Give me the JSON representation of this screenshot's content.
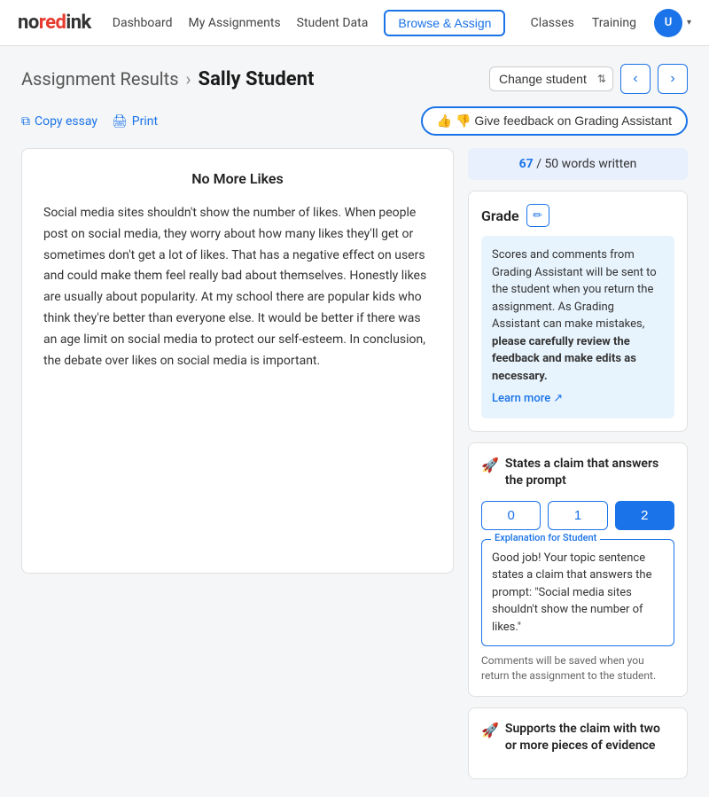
{
  "brand": {
    "no": "no",
    "red": "red",
    "ink": "ink"
  },
  "navbar": {
    "links": [
      {
        "label": "Dashboard",
        "id": "dashboard"
      },
      {
        "label": "My Assignments",
        "id": "my-assignments"
      },
      {
        "label": "Student Data",
        "id": "student-data"
      }
    ],
    "browse_assign": "Browse & Assign",
    "right_links": [
      {
        "label": "Classes",
        "id": "classes"
      },
      {
        "label": "Training",
        "id": "training"
      }
    ],
    "avatar_initials": "U"
  },
  "header": {
    "breadcrumb_link": "Assignment Results",
    "arrow": "›",
    "student_name": "Sally Student",
    "change_student_label": "Change student",
    "change_student_placeholder": "Change student"
  },
  "actions": {
    "copy_essay": "Copy essay",
    "print": "Print",
    "feedback_btn": "👍 👎 Give feedback on Grading Assistant"
  },
  "word_count": {
    "written": "67",
    "target": "50",
    "label": "words written"
  },
  "grade": {
    "label": "Grade",
    "edit_icon": "✏"
  },
  "grading_info": {
    "text1": "Scores and comments from Grading Assistant will be sent to the student when you return the assignment. As Grading Assistant can make mistakes, ",
    "bold": "please carefully review the feedback and make edits as necessary.",
    "learn_more": "Learn more",
    "ext_icon": "↗"
  },
  "criteria1": {
    "icon": "🚀",
    "title": "States a claim that answers the prompt",
    "scores": [
      "0",
      "1",
      "2"
    ],
    "active_score": 2,
    "explanation_label": "Explanation for Student",
    "explanation": "Good job! Your topic sentence states a claim that answers the prompt: \"Social media sites shouldn't show the number of likes.\"",
    "save_note": "Comments will be saved when you return the assignment to the student."
  },
  "criteria2": {
    "icon": "🚀",
    "title": "Supports the claim with two or more pieces of evidence"
  },
  "essay": {
    "title": "No More Likes",
    "body": "Social media sites shouldn't show the number of likes. When people post on social media, they worry about how many likes they'll get or sometimes don't get a lot of likes. That has a negative effect on users and could make them feel really bad about themselves. Honestly likes are usually about popularity. At my school there are popular kids who think they're better than everyone else. It would be better if there was an age limit on social media to protect our self-esteem. In conclusion, the debate over likes on social media is important."
  }
}
